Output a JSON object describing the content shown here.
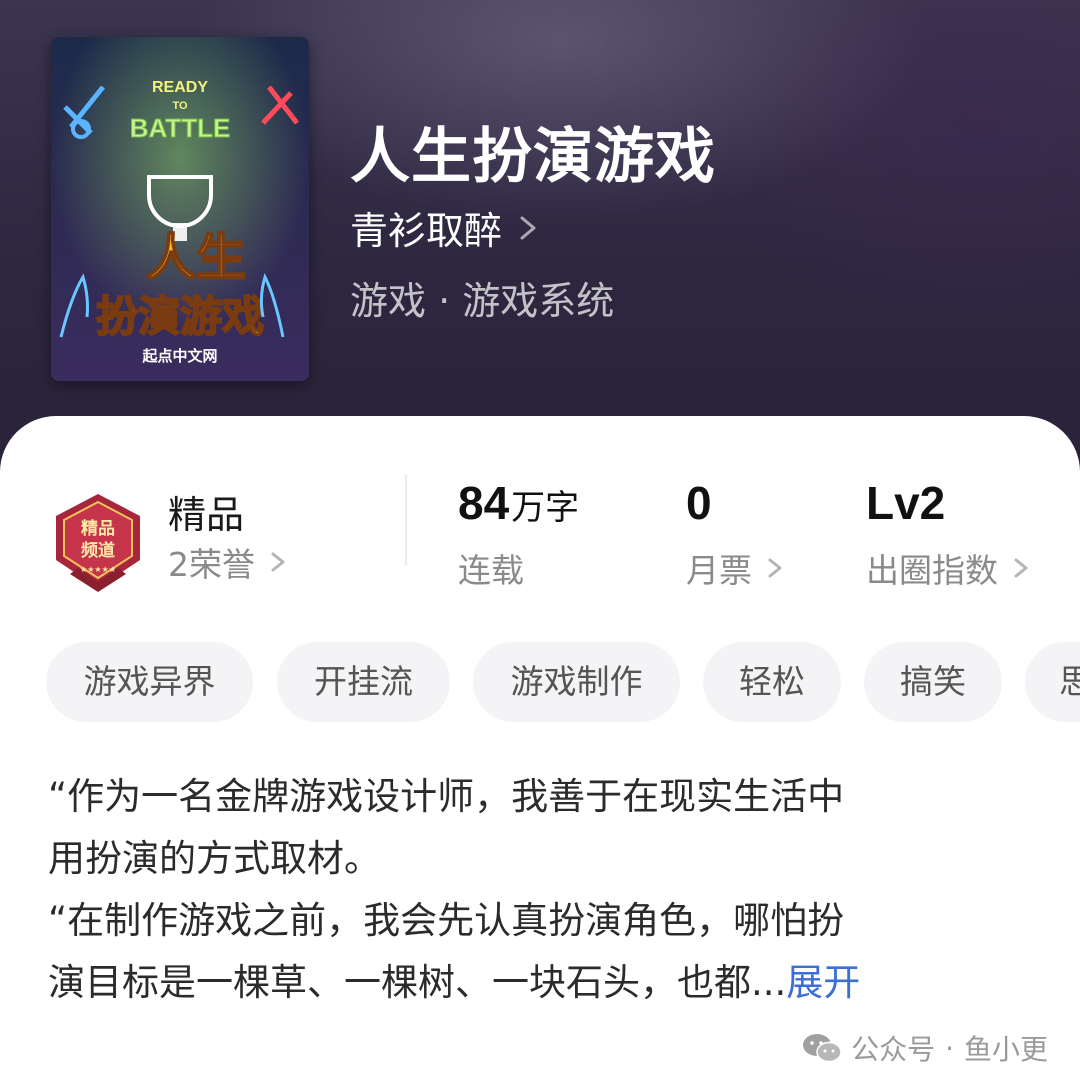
{
  "header": {
    "cover": {
      "top_text": "READY",
      "mid_text": "TO",
      "battle_text": "BATTLE",
      "title_line1": "人生",
      "title_line2": "扮演游戏",
      "publisher": "起点中文网"
    },
    "title": "人生扮演游戏",
    "author": "青衫取醉",
    "genre": "游戏 · 游戏系统"
  },
  "stats": {
    "badge_text_line1": "精品",
    "badge_text_line2": "频道",
    "badge_stars": "★★★★★",
    "quality_label": "精品",
    "honors": "2荣誉",
    "word_count_number": "84",
    "word_count_unit": "万字",
    "status": "连载",
    "monthly_votes_value": "0",
    "monthly_votes_label": "月票",
    "influence_value": "Lv2",
    "influence_label": "出圈指数"
  },
  "tags": [
    "游戏异界",
    "开挂流",
    "游戏制作",
    "轻松",
    "搞笑",
    "思"
  ],
  "synopsis": {
    "line1": "“作为一名金牌游戏设计师，我善于在现实生活中",
    "line2": "用扮演的方式取材。",
    "line3": "“在制作游戏之前，我会先认真扮演角色，哪怕扮",
    "line4": "演目标是一棵草、一棵树、一块石头，也都...",
    "expand": "展开"
  },
  "watermark": {
    "account": "公众号",
    "separator": "·",
    "name": "鱼小更"
  },
  "colors": {
    "header_bg": "#2e2740",
    "link_blue": "#3b6fd6",
    "tag_bg": "#f4f4f6",
    "badge_red": "#a8263c"
  },
  "icons": {
    "author_chevron": "chevron-right-icon",
    "badge": "premium-channel-badge-icon",
    "watermark": "wechat-icon"
  }
}
